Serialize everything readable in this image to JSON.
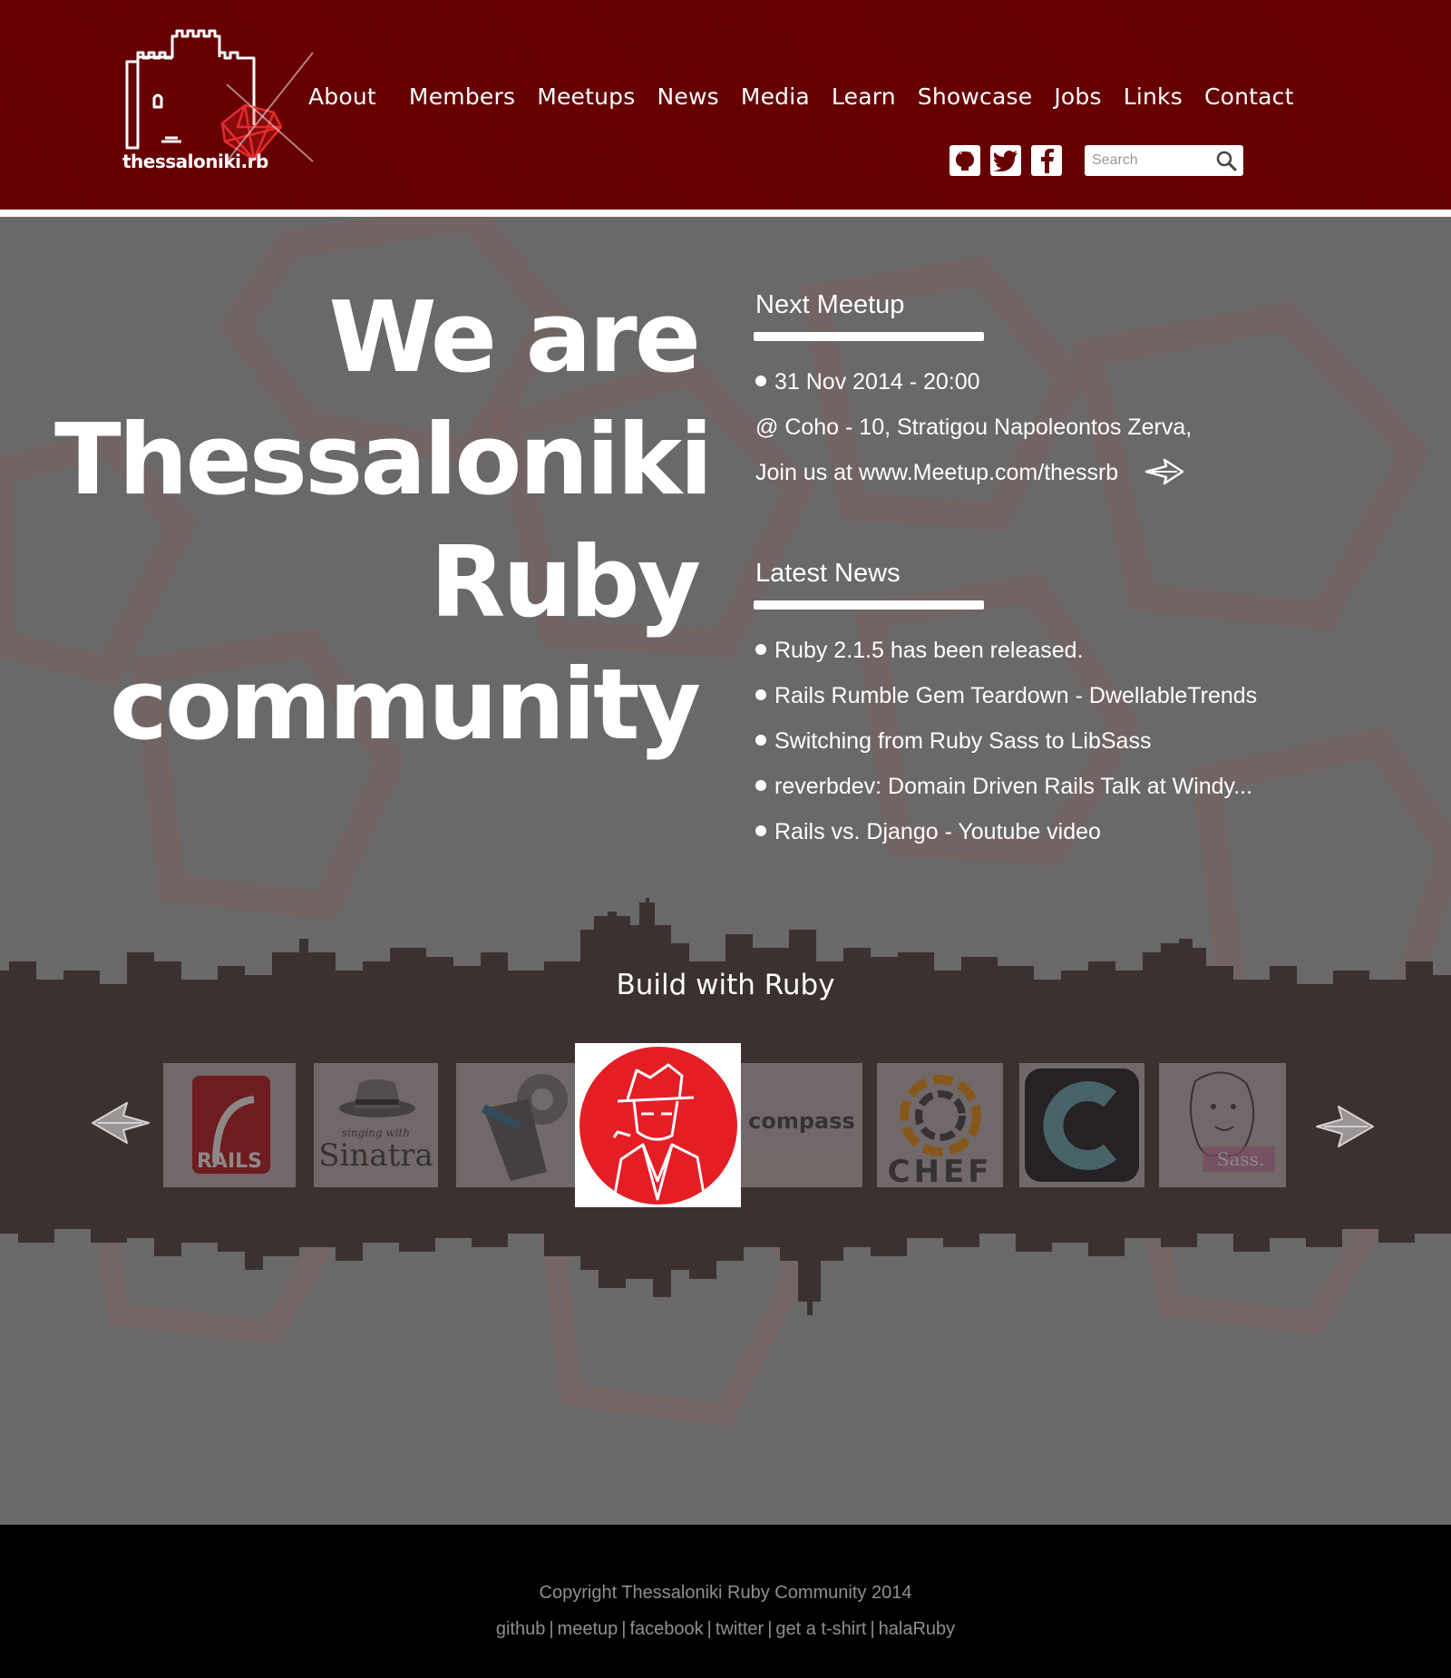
{
  "site": {
    "logo_text": "thessaloniki.rb"
  },
  "nav": {
    "items": [
      {
        "label": "About"
      },
      {
        "label": "Members"
      },
      {
        "label": "Meetups"
      },
      {
        "label": "News"
      },
      {
        "label": "Media"
      },
      {
        "label": "Learn"
      },
      {
        "label": "Showcase"
      },
      {
        "label": "Jobs"
      },
      {
        "label": "Links"
      },
      {
        "label": "Contact"
      }
    ]
  },
  "social": {
    "icons": [
      "github-icon",
      "twitter-icon",
      "facebook-icon"
    ]
  },
  "search": {
    "placeholder": "Search",
    "value": ""
  },
  "hero": {
    "lines": [
      "We are",
      "Thessaloniki",
      "Ruby",
      "community"
    ]
  },
  "next_meetup": {
    "heading": "Next Meetup",
    "date": "31 Nov 2014 - 20:00",
    "venue": "@ Coho -  10, Stratigou Napoleontos Zerva,",
    "join": "Join us at www.Meetup.com/thessrb"
  },
  "latest_news": {
    "heading": "Latest News",
    "items": [
      "Ruby 2.1.5 has been released.",
      "Rails Rumble Gem Teardown - DwellableTrends",
      "Switching from Ruby Sass to LibSass",
      "reverbdev: Domain Driven Rails Talk at Windy...",
      "Rails vs. Django - Youtube video"
    ]
  },
  "build": {
    "heading": "Build with Ruby",
    "tiles": [
      "RAILS",
      "singing with",
      "Sinatra",
      "compass",
      "CHEF",
      "Sass."
    ]
  },
  "footer": {
    "copyright": "Copyright Thessaloniki Ruby Community 2014",
    "links": [
      "github",
      "meetup",
      "facebook",
      "twitter",
      "get a t-shirt",
      "halaRuby"
    ]
  },
  "colors": {
    "header_bg": "#680003",
    "body_bg": "#6a6868",
    "skyline": "#3a3130",
    "footer_bg": "#000000",
    "ruby_red": "#e52b2b"
  }
}
